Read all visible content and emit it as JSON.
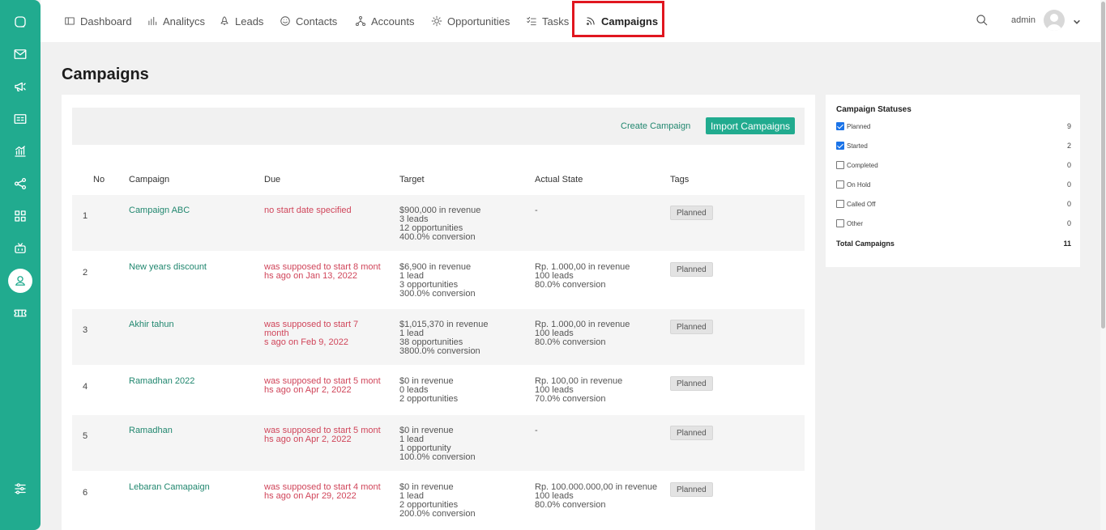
{
  "nav": {
    "items": [
      {
        "label": "Dashboard",
        "icon": "dashboard-icon"
      },
      {
        "label": "Analitycs",
        "icon": "bar-chart-icon"
      },
      {
        "label": "Leads",
        "icon": "rocket-icon"
      },
      {
        "label": "Contacts",
        "icon": "smile-icon"
      },
      {
        "label": "Accounts",
        "icon": "network-icon"
      },
      {
        "label": "Opportunities",
        "icon": "sun-icon"
      },
      {
        "label": "Tasks",
        "icon": "checklist-icon"
      },
      {
        "label": "Campaigns",
        "icon": "rss-icon"
      }
    ],
    "active": "Campaigns",
    "user": "admin"
  },
  "sidebar": {
    "icons": [
      "chat-icon",
      "mail-icon",
      "megaphone-icon",
      "id-card-icon",
      "analytics-icon",
      "share-icon",
      "grid-icon",
      "bot-icon",
      "user-icon",
      "ticket-icon",
      "settings-sliders-icon"
    ],
    "active": "user-icon"
  },
  "page": {
    "title": "Campaigns",
    "create_label": "Create Campaign",
    "import_label": "Import Campaigns"
  },
  "table": {
    "headers": [
      "No",
      "Campaign",
      "Due",
      "Target",
      "Actual State",
      "Tags"
    ],
    "rows": [
      {
        "no": "1",
        "name": "Campaign ABC",
        "due": [
          "no start date specified"
        ],
        "target": [
          "$900,000 in revenue",
          "3 leads",
          "12 opportunities",
          "400.0% conversion"
        ],
        "state": [
          "-"
        ],
        "tag": "Planned"
      },
      {
        "no": "2",
        "name": "New years discount",
        "due": [
          "was supposed to start 8 mont",
          "hs ago on Jan 13, 2022"
        ],
        "target": [
          "$6,900 in revenue",
          "1 lead",
          "3 opportunities",
          "300.0% conversion"
        ],
        "state": [
          "Rp. 1.000,00 in revenue",
          "100 leads",
          "80.0% conversion"
        ],
        "tag": "Planned"
      },
      {
        "no": "3",
        "name": "Akhir tahun",
        "due": [
          "was supposed to start 7 month",
          "s ago on Feb 9, 2022"
        ],
        "target": [
          "$1,015,370 in revenue",
          "1 lead",
          "38 opportunities",
          "3800.0% conversion"
        ],
        "state": [
          "Rp. 1.000,00 in revenue",
          "100 leads",
          "80.0% conversion"
        ],
        "tag": "Planned"
      },
      {
        "no": "4",
        "name": "Ramadhan 2022",
        "due": [
          "was supposed to start 5 mont",
          "hs ago on Apr 2, 2022"
        ],
        "target": [
          "$0 in revenue",
          "0 leads",
          "2 opportunities"
        ],
        "state": [
          "Rp. 100,00 in revenue",
          "100 leads",
          "70.0% conversion"
        ],
        "tag": "Planned"
      },
      {
        "no": "5",
        "name": "Ramadhan",
        "due": [
          "was supposed to start 5 mont",
          "hs ago on Apr 2, 2022"
        ],
        "target": [
          "$0 in revenue",
          "1 lead",
          "1 opportunity",
          "100.0% conversion"
        ],
        "state": [
          "-"
        ],
        "tag": "Planned"
      },
      {
        "no": "6",
        "name": "Lebaran Camapaign",
        "due": [
          "was supposed to start 4 mont",
          "hs ago on Apr 29, 2022"
        ],
        "target": [
          "$0 in revenue",
          "1 lead",
          "2 opportunities",
          "200.0% conversion"
        ],
        "state": [
          "Rp. 100.000.000,00 in revenue",
          "100 leads",
          "80.0% conversion"
        ],
        "tag": "Planned"
      }
    ]
  },
  "statuses": {
    "title": "Campaign Statuses",
    "items": [
      {
        "label": "Planned",
        "count": "9",
        "checked": true
      },
      {
        "label": "Started",
        "count": "2",
        "checked": true
      },
      {
        "label": "Completed",
        "count": "0",
        "checked": false
      },
      {
        "label": "On Hold",
        "count": "0",
        "checked": false
      },
      {
        "label": "Called Off",
        "count": "0",
        "checked": false
      },
      {
        "label": "Other",
        "count": "0",
        "checked": false
      }
    ],
    "total_label": "Total Campaigns",
    "total_count": "11"
  },
  "colors": {
    "brand": "#21ab8f",
    "link": "#21876f",
    "due": "#d0455a",
    "highlight": "#e0161f"
  }
}
